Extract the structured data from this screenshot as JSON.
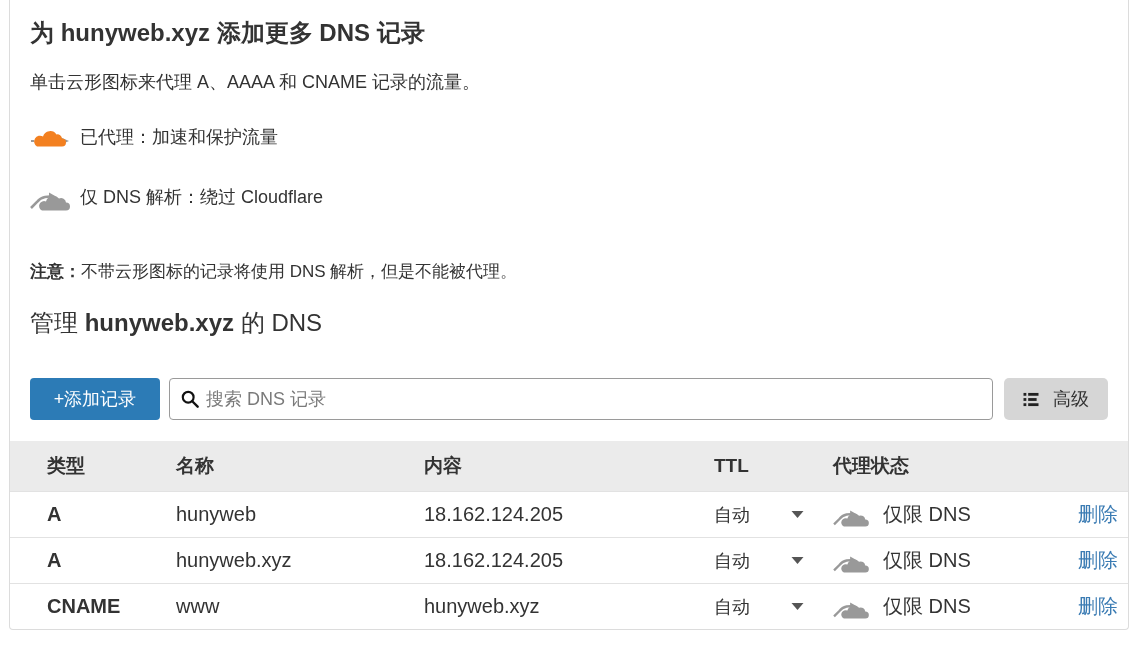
{
  "intro": {
    "title": "为 hunyweb.xyz 添加更多 DNS 记录",
    "description": "单击云形图标来代理 A、AAAA 和 CNAME 记录的流量。",
    "legend": [
      {
        "proxied": true,
        "text": "已代理：加速和保护流量"
      },
      {
        "proxied": false,
        "text": "仅 DNS 解析：绕过 Cloudflare"
      }
    ],
    "note": "**注意：**不带云形图标的记录将使用 DNS 解析，但是不能被代理。"
  },
  "manage": {
    "heading": "管理 **hunyweb.xyz** 的 DNS",
    "add_button": "+添加记录",
    "search": {
      "placeholder": "搜索 DNS 记录"
    },
    "advanced_button": "高级"
  },
  "table": {
    "columns": [
      "类型",
      "名称",
      "内容",
      "TTL",
      "代理状态"
    ],
    "rows": [
      {
        "type": "A",
        "name": "hunyweb",
        "content": "18.162.124.205",
        "ttl": "自动",
        "proxied": false,
        "status": "仅限 DNS",
        "action": "删除"
      },
      {
        "type": "A",
        "name": "hunyweb.xyz",
        "content": "18.162.124.205",
        "ttl": "自动",
        "proxied": false,
        "status": "仅限 DNS",
        "action": "删除"
      },
      {
        "type": "CNAME",
        "name": "www",
        "content": "hunyweb.xyz",
        "ttl": "自动",
        "proxied": false,
        "status": "仅限 DNS",
        "action": "删除"
      }
    ]
  }
}
